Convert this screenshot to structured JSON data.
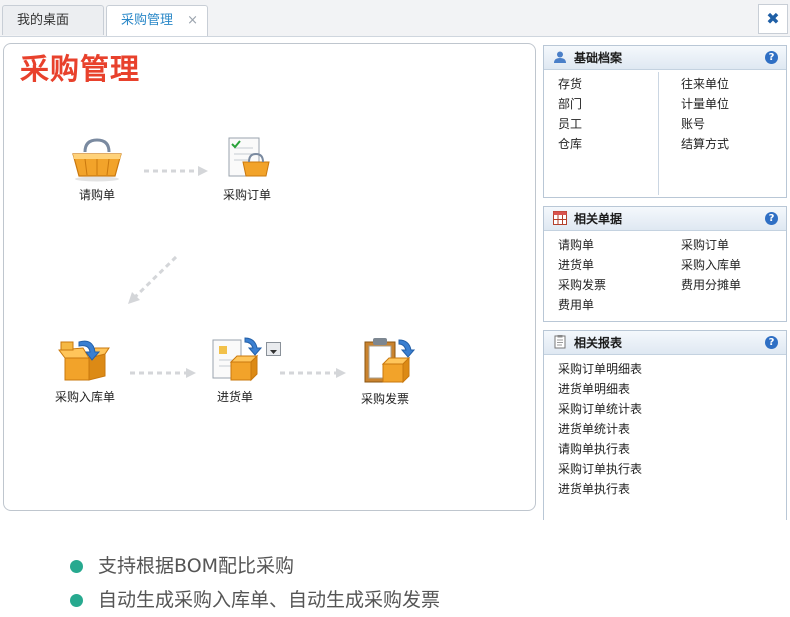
{
  "tabs": [
    {
      "label": "我的桌面"
    },
    {
      "label": "采购管理",
      "close": "×"
    }
  ],
  "close_all": "✖",
  "main": {
    "title": "采购管理",
    "nodes": {
      "purchase_request": "请购单",
      "purchase_order": "采购订单",
      "purchase_receipt": "采购入库单",
      "goods_receipt": "进货单",
      "purchase_invoice": "采购发票"
    }
  },
  "panels": {
    "basic": {
      "title": "基础档案",
      "left": [
        "存货",
        "部门",
        "员工",
        "仓库"
      ],
      "right": [
        "往来单位",
        "计量单位",
        "账号",
        "结算方式"
      ]
    },
    "docs": {
      "title": "相关单据",
      "left": [
        "请购单",
        "进货单",
        "采购发票",
        "费用单"
      ],
      "right": [
        "采购订单",
        "采购入库单",
        "费用分摊单"
      ]
    },
    "reports": {
      "title": "相关报表",
      "items": [
        "采购订单明细表",
        "进货单明细表",
        "采购订单统计表",
        "进货单统计表",
        "请购单执行表",
        "采购订单执行表",
        "进货单执行表"
      ]
    },
    "help": "?"
  },
  "bullets": [
    "支持根据BOM配比采购",
    "自动生成采购入库单、自动生成采购发票"
  ],
  "colors": {
    "title_red": "#e8412c",
    "tab_active_text": "#2a88c8",
    "bullet_dot": "#27a98f",
    "box_orange": "#f5a623"
  }
}
